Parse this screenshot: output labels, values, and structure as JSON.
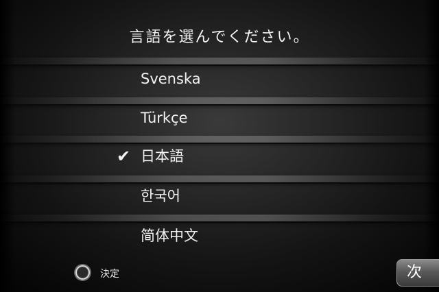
{
  "title": "言語を選んでください。",
  "languages": [
    {
      "label": "Svenska",
      "selected": false
    },
    {
      "label": "Türkçe",
      "selected": false
    },
    {
      "label": "日本語",
      "selected": true
    },
    {
      "label": "한국어",
      "selected": false
    },
    {
      "label": "简体中文",
      "selected": false
    }
  ],
  "check_mark": "✔",
  "footer": {
    "confirm_icon": "circle-button-icon",
    "confirm_label": "決定",
    "next_label": "次"
  },
  "colors": {
    "text": "#f2f2f2",
    "background": "#262626"
  }
}
